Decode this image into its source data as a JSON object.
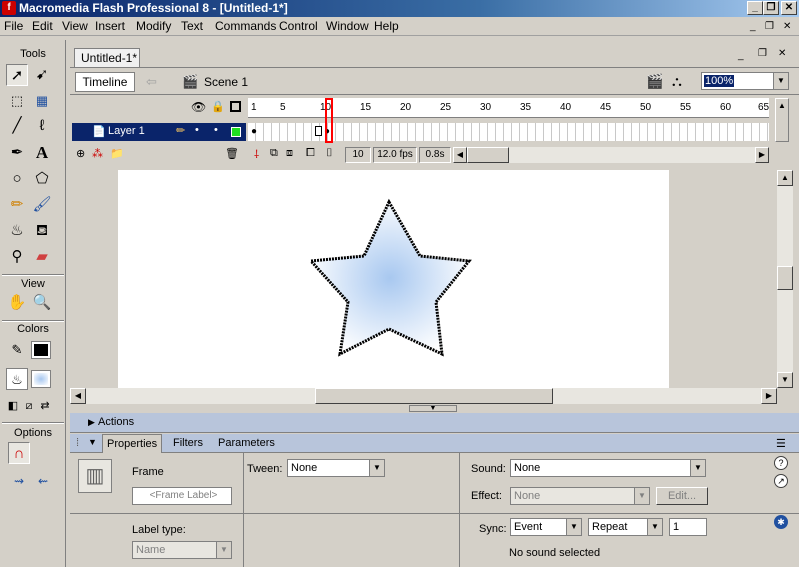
{
  "window": {
    "title": "Macromedia Flash Professional 8 - [Untitled-1*]",
    "logo": "f"
  },
  "menu": [
    "File",
    "Edit",
    "View",
    "Insert",
    "Modify",
    "Text",
    "Commands",
    "Control",
    "Window",
    "Help"
  ],
  "tools": {
    "tools_label": "Tools",
    "view_label": "View",
    "colors_label": "Colors",
    "options_label": "Options"
  },
  "document": {
    "tab": "Untitled-1*",
    "timeline_button": "Timeline",
    "scene": "Scene 1",
    "zoom": "100%"
  },
  "timeline": {
    "ruler": [
      "1",
      "5",
      "10",
      "15",
      "20",
      "25",
      "30",
      "35",
      "40",
      "45",
      "50",
      "55",
      "60",
      "65"
    ],
    "layer_name": "Layer 1",
    "current_frame": "10",
    "fps": "12.0 fps",
    "elapsed": "0.8s"
  },
  "panels": {
    "actions": "Actions",
    "tabs": [
      "Properties",
      "Filters",
      "Parameters"
    ]
  },
  "properties": {
    "type": "Frame",
    "frame_label_placeholder": "<Frame Label>",
    "label_type_label": "Label type:",
    "label_type_value": "Name",
    "tween_label": "Tween:",
    "tween_value": "None",
    "sound_label": "Sound:",
    "sound_value": "None",
    "effect_label": "Effect:",
    "effect_value": "None",
    "edit_button": "Edit...",
    "sync_label": "Sync:",
    "sync_value": "Event",
    "repeat_value": "Repeat",
    "repeat_count": "1",
    "sound_status": "No sound selected"
  },
  "colors": {
    "stroke": "#000000",
    "fill_center": "#a8c8f0",
    "fill_edge": "#ffffff",
    "playhead": "#ff0000",
    "layer_selected": "#0a246a"
  }
}
